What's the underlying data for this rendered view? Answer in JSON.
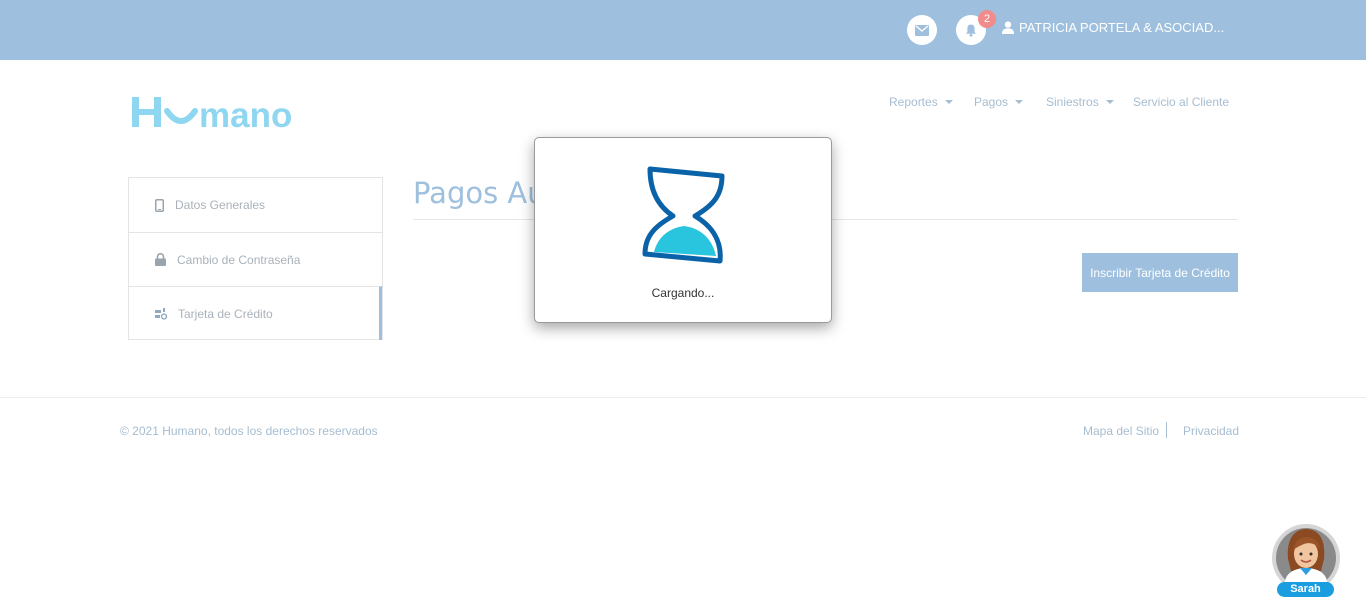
{
  "topbar": {
    "notification_count": "2",
    "user_name": "PATRICIA PORTELA & ASOCIAD..."
  },
  "brand": {
    "logo_text": "Humano",
    "color": "#8fd6f0"
  },
  "nav": {
    "items": [
      {
        "label": "Reportes",
        "dropdown": true
      },
      {
        "label": "Pagos",
        "dropdown": true
      },
      {
        "label": "Siniestros",
        "dropdown": true
      },
      {
        "label": "Servicio al Cliente",
        "dropdown": false
      }
    ]
  },
  "sidebar": {
    "items": [
      {
        "label": "Datos Generales",
        "icon": "mobile-icon"
      },
      {
        "label": "Cambio de Contraseña",
        "icon": "lock-icon"
      },
      {
        "label": "Tarjeta de Crédito",
        "icon": "card-settings-icon",
        "active": true
      }
    ]
  },
  "main": {
    "title": "Pagos Au",
    "add_card_button": "Inscribir Tarjeta de Crédito"
  },
  "modal": {
    "loading_text": "Cargando..."
  },
  "footer": {
    "copyright": "© 2021 Humano, todos los derechos reservados",
    "links": [
      "Mapa del Sitio",
      "Privacidad"
    ]
  },
  "chat": {
    "assistant_name": "Sarah"
  },
  "colors": {
    "topbar": "#9ec0de",
    "accent": "#9ec0de",
    "badge": "#f28b8b",
    "hourglass_frame": "#0a63a8",
    "hourglass_sand": "#29c5de"
  }
}
